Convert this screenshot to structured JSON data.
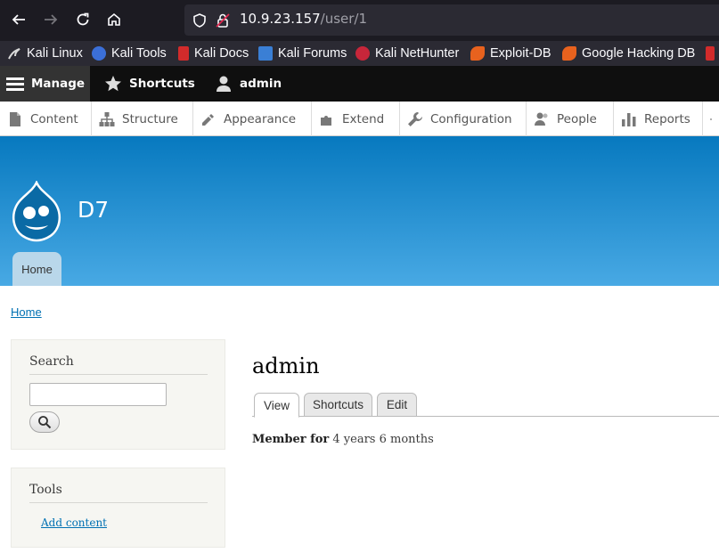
{
  "browser": {
    "url_host": "10.9.23.157",
    "url_path": "/user/1",
    "bookmarks": [
      {
        "label": "Kali Linux",
        "icon": "kali-dragon-icon"
      },
      {
        "label": "Kali Tools",
        "icon": "kali-tools-icon"
      },
      {
        "label": "Kali Docs",
        "icon": "kali-docs-icon"
      },
      {
        "label": "Kali Forums",
        "icon": "kali-forums-icon"
      },
      {
        "label": "Kali NetHunter",
        "icon": "nethunter-icon"
      },
      {
        "label": "Exploit-DB",
        "icon": "exploit-db-icon"
      },
      {
        "label": "Google Hacking DB",
        "icon": "ghdb-icon"
      }
    ]
  },
  "toolbar": {
    "manage": "Manage",
    "shortcuts": "Shortcuts",
    "user": "admin"
  },
  "tray": [
    {
      "label": "Content",
      "icon": "content-icon"
    },
    {
      "label": "Structure",
      "icon": "structure-icon"
    },
    {
      "label": "Appearance",
      "icon": "appearance-icon"
    },
    {
      "label": "Extend",
      "icon": "extend-icon"
    },
    {
      "label": "Configuration",
      "icon": "wrench-icon"
    },
    {
      "label": "People",
      "icon": "people-icon"
    },
    {
      "label": "Reports",
      "icon": "reports-icon"
    }
  ],
  "site": {
    "name": "D7",
    "home_tab": "Home"
  },
  "breadcrumb": "Home",
  "sidebar": {
    "search_title": "Search",
    "search_value": "",
    "tools_title": "Tools",
    "tools_link": "Add content"
  },
  "main": {
    "title": "admin",
    "tabs": [
      "View",
      "Shortcuts",
      "Edit"
    ],
    "member_label": "Member for",
    "member_value": "4 years 6 months"
  },
  "colors": {
    "header_top": "#0779bf",
    "header_bottom": "#48a9e4",
    "link": "#0071b3",
    "toolbar_bg": "#0f0f0f"
  }
}
